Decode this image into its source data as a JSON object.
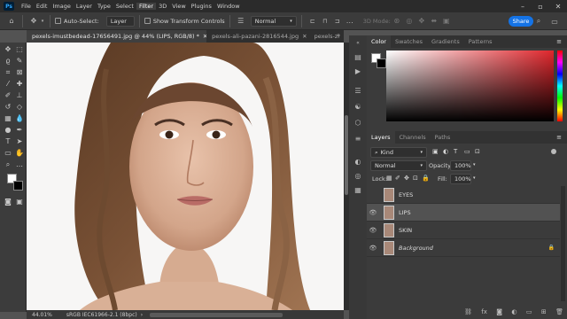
{
  "menubar": {
    "logo": "Ps",
    "items": [
      "File",
      "Edit",
      "Image",
      "Layer",
      "Type",
      "Select",
      "Filter",
      "3D",
      "View",
      "Plugins",
      "Window"
    ],
    "active_index": 6
  },
  "options": {
    "autoselect_label": "Auto-Select:",
    "autoselect_value": "Layer",
    "transform_label": "Show Transform Controls",
    "blend_value": "Normal",
    "mode3d_label": "3D Mode:",
    "share_label": "Share"
  },
  "tabs": [
    {
      "label": "pexels-imustbedead-17656491.jpg @ 44% (LIPS, RGB/8) *",
      "active": true
    },
    {
      "label": "pexels-ali-pazani-2816544.jpg",
      "active": false
    },
    {
      "label": "pexels-zi",
      "active": false
    }
  ],
  "status": {
    "zoom": "44.01%",
    "profile": "sRGB IEC61966-2.1 (8bpc)"
  },
  "color_panel": {
    "tabs": [
      "Color",
      "Swatches",
      "Gradients",
      "Patterns"
    ],
    "accent": "#e0262c"
  },
  "layers_panel": {
    "tabs": [
      "Layers",
      "Channels",
      "Paths"
    ],
    "filter_kind": "Kind",
    "blend_mode": "Normal",
    "opacity_label": "Opacity:",
    "opacity_value": "100%",
    "lock_label": "Lock:",
    "fill_label": "Fill:",
    "fill_value": "100%",
    "layers": [
      {
        "name": "EYES",
        "visible": false,
        "italic": false
      },
      {
        "name": "LIPS",
        "visible": true,
        "italic": false
      },
      {
        "name": "SKIN",
        "visible": true,
        "italic": false
      },
      {
        "name": "Background",
        "visible": true,
        "italic": true
      }
    ]
  }
}
